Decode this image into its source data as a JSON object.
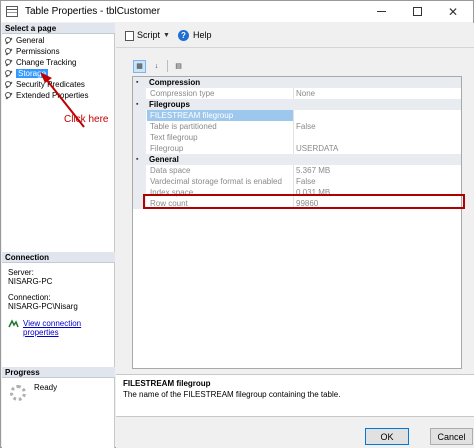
{
  "window": {
    "title": "Table Properties - tblCustomer"
  },
  "sidebar": {
    "header": "Select a page",
    "items": [
      {
        "label": "General",
        "selected": false
      },
      {
        "label": "Permissions",
        "selected": false
      },
      {
        "label": "Change Tracking",
        "selected": false
      },
      {
        "label": "Storage",
        "selected": true
      },
      {
        "label": "Security Predicates",
        "selected": false
      },
      {
        "label": "Extended Properties",
        "selected": false
      }
    ],
    "annotation": "Click here",
    "annotation_color": "#c00000"
  },
  "connection": {
    "header": "Connection",
    "server_label": "Server:",
    "server_value": "NISARG-PC",
    "conn_label": "Connection:",
    "conn_value": "NISARG-PC\\Nisarg",
    "link": "View connection properties"
  },
  "progress": {
    "header": "Progress",
    "status": "Ready"
  },
  "toolbar": {
    "script_label": "Script",
    "help_label": "Help"
  },
  "grid": {
    "sections": [
      {
        "name": "Compression",
        "rows": [
          {
            "name": "Compression type",
            "value": "None"
          }
        ]
      },
      {
        "name": "Filegroups",
        "rows": [
          {
            "name": "FILESTREAM filegroup",
            "value": ""
          },
          {
            "name": "Table is partitioned",
            "value": "False"
          },
          {
            "name": "Text filegroup",
            "value": ""
          },
          {
            "name": "Filegroup",
            "value": "USERDATA"
          }
        ]
      },
      {
        "name": "General",
        "rows": [
          {
            "name": "Data space",
            "value": "5.367 MB"
          },
          {
            "name": "Vardecimal storage format is enabled",
            "value": "False"
          },
          {
            "name": "Index space",
            "value": "0.031 MB"
          },
          {
            "name": "Row count",
            "value": "99860"
          }
        ]
      }
    ],
    "highlight_color": "#b00000"
  },
  "description": {
    "title": "FILESTREAM filegroup",
    "text": "The name of the FILESTREAM filegroup containing the table."
  },
  "buttons": {
    "ok": "OK",
    "cancel": "Cancel"
  }
}
